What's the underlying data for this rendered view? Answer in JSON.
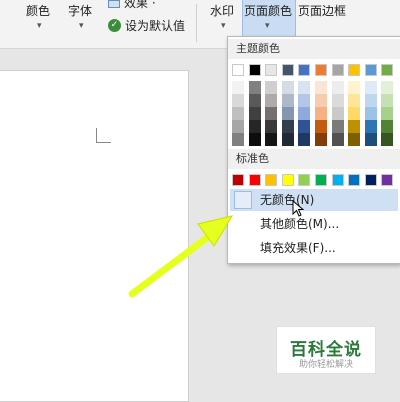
{
  "ribbon": {
    "color_label": "颜色",
    "font_label": "字体",
    "effects_label": "效果 ·",
    "set_default_label": "设为默认值",
    "watermark_label": "水印",
    "page_color_label": "页面颜色",
    "page_border_label": "页面边框"
  },
  "dropdown": {
    "theme_colors_header": "主题颜色",
    "standard_colors_header": "标准色",
    "no_color_label": "无颜色(N)",
    "more_colors_label": "其他颜色(M)...",
    "fill_effects_label": "填充效果(F)..."
  },
  "theme_colors_top": [
    "#ffffff",
    "#000000",
    "#e7e6e6",
    "#44546a",
    "#4472c4",
    "#ed7d31",
    "#a5a5a5",
    "#ffc000",
    "#5b9bd5",
    "#70ad47"
  ],
  "theme_colors_shades": [
    [
      "#f2f2f2",
      "#808080",
      "#d0cece",
      "#d6dce4",
      "#d9e2f3",
      "#fbe5d5",
      "#ededed",
      "#fff2cc",
      "#deebf6",
      "#e2efd9"
    ],
    [
      "#d9d9d9",
      "#595959",
      "#aeaaaa",
      "#adb9ca",
      "#b4c6e7",
      "#f7cbac",
      "#dbdbdb",
      "#fee599",
      "#bdd7ee",
      "#c5e0b3"
    ],
    [
      "#bfbfbf",
      "#404040",
      "#757070",
      "#8496b0",
      "#8eaadb",
      "#f4b183",
      "#c9c9c9",
      "#ffd965",
      "#9cc3e5",
      "#a8d08d"
    ],
    [
      "#a6a6a6",
      "#262626",
      "#3a3838",
      "#323f4f",
      "#2f5496",
      "#c55a11",
      "#7b7b7b",
      "#bf9000",
      "#2e75b5",
      "#538135"
    ],
    [
      "#808080",
      "#0d0d0d",
      "#171616",
      "#222a35",
      "#1f3864",
      "#833c0b",
      "#525252",
      "#7f6000",
      "#1e4e79",
      "#375623"
    ]
  ],
  "standard_colors": [
    "#c00000",
    "#ff0000",
    "#ffc000",
    "#ffff00",
    "#92d050",
    "#00b050",
    "#00b0f0",
    "#0070c0",
    "#002060",
    "#7030a0"
  ],
  "logo": {
    "main": "百科全说",
    "sub": "助你轻松解决"
  }
}
